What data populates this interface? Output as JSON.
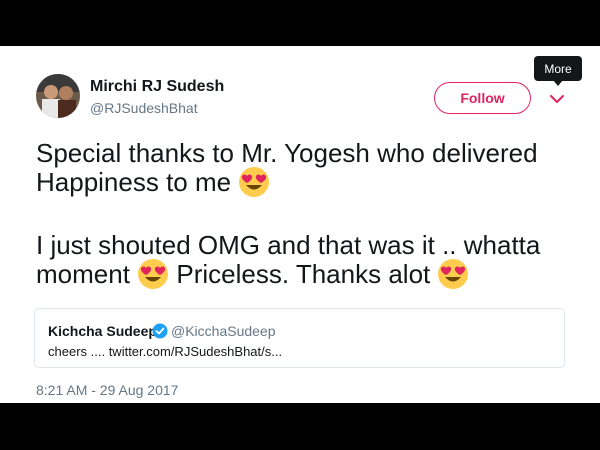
{
  "author": {
    "display_name": "Mirchi RJ Sudesh",
    "handle": "@RJSudeshBhat"
  },
  "follow_label": "Follow",
  "more_tooltip": "More",
  "tweet": {
    "line1": "Special thanks to Mr. Yogesh who delivered",
    "line2": "Happiness to me",
    "line3": "I just shouted OMG and that was it .. whatta",
    "line4a": "moment",
    "line4b": "Priceless. Thanks alot"
  },
  "emoji_icon": "heart-eyes-emoji",
  "quoted_tweet": {
    "name": "Kichcha Sudeepa",
    "handle": "@KicchaSudeep",
    "text": "cheers .... twitter.com/RJSudeshBhat/s..."
  },
  "timestamp": "8:21 AM - 29 Aug 2017",
  "colors": {
    "accent": "#e0245e",
    "verified": "#1da1f2",
    "text": "#14171a",
    "muted": "#657786"
  }
}
